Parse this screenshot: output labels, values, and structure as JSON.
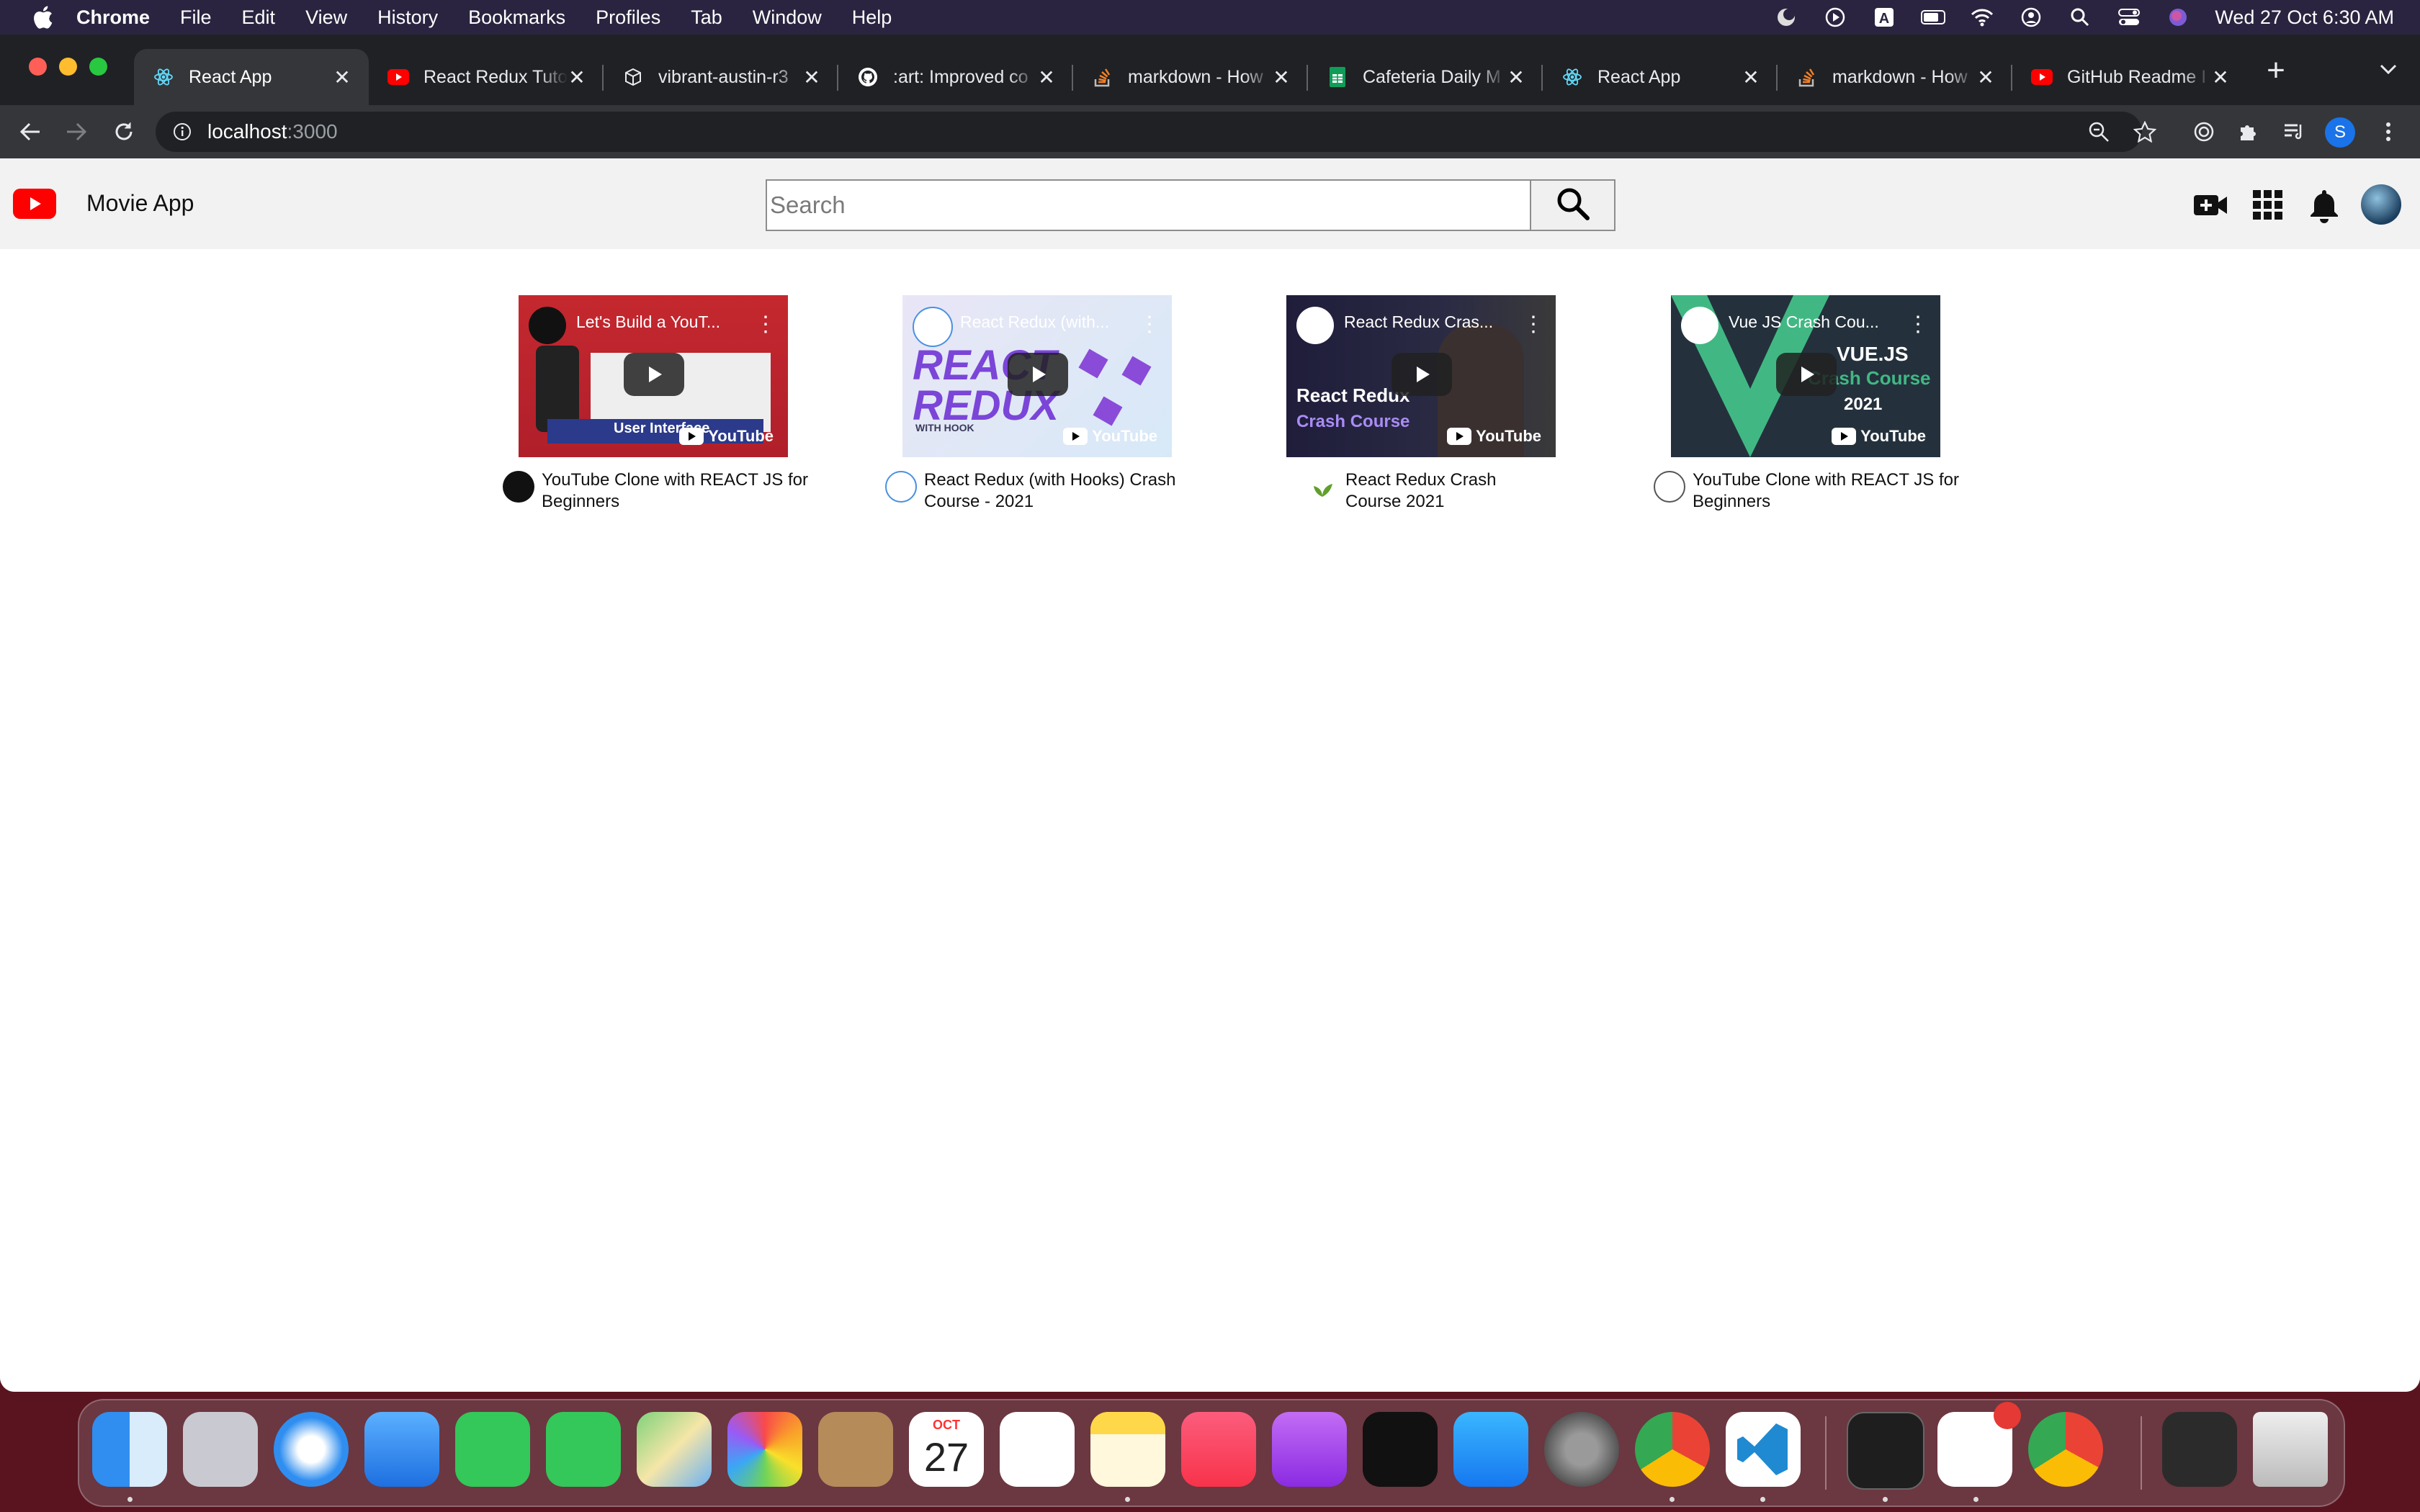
{
  "menubar": {
    "app_name": "Chrome",
    "items": [
      "File",
      "Edit",
      "View",
      "History",
      "Bookmarks",
      "Profiles",
      "Tab",
      "Window",
      "Help"
    ],
    "clock": "Wed 27 Oct  6:30 AM"
  },
  "browser": {
    "tabs": [
      {
        "title": "React App",
        "favicon": "react-icon",
        "active": true
      },
      {
        "title": "React Redux Tuto",
        "favicon": "youtube-icon"
      },
      {
        "title": "vibrant-austin-r3",
        "favicon": "codesandbox-icon"
      },
      {
        "title": ":art: Improved co",
        "favicon": "github-icon"
      },
      {
        "title": "markdown - How",
        "favicon": "stackoverflow-icon"
      },
      {
        "title": "Cafeteria Daily M",
        "favicon": "sheets-icon"
      },
      {
        "title": "React App",
        "favicon": "react-icon"
      },
      {
        "title": "markdown - How",
        "favicon": "stackoverflow-icon"
      },
      {
        "title": "GitHub Readme I",
        "favicon": "youtube-icon"
      }
    ],
    "url_host": "localhost",
    "url_port": ":3000",
    "profile_initial": "S"
  },
  "app": {
    "title": "Movie App",
    "search_placeholder": "Search",
    "videos": [
      {
        "thumb_title": "Let's Build a YouT...",
        "overlay_text": "User Interface",
        "title": "YouTube Clone with REACT JS for Beginners"
      },
      {
        "thumb_title": "React Redux (with...",
        "overlay_text": "REACT REDUX",
        "overlay_sub": "WITH HOOK",
        "title": "React Redux (with Hooks) Crash Course - 2021"
      },
      {
        "thumb_title": "React Redux Cras...",
        "overlay_text": "React Redux",
        "overlay_sub": "Crash Course",
        "title": "React Redux Crash Course 2021"
      },
      {
        "thumb_title": "Vue JS Crash Cou...",
        "overlay_text": "VUE.JS",
        "overlay_sub": "Crash Course",
        "overlay_year": "2021",
        "title": "YouTube Clone with REACT JS for Beginners"
      }
    ],
    "youtube_badge": "YouTube"
  },
  "dock": {
    "calendar_month": "OCT",
    "calendar_day": "27",
    "apps": [
      "finder",
      "launchpad",
      "safari",
      "mail",
      "facetime",
      "messages",
      "maps",
      "photos",
      "contacts",
      "calendar",
      "reminders",
      "notes",
      "music",
      "podcasts",
      "tv",
      "app-store",
      "system-preferences",
      "chrome",
      "vscode",
      "terminal",
      "slack",
      "chrome",
      "downloads",
      "trash"
    ]
  }
}
